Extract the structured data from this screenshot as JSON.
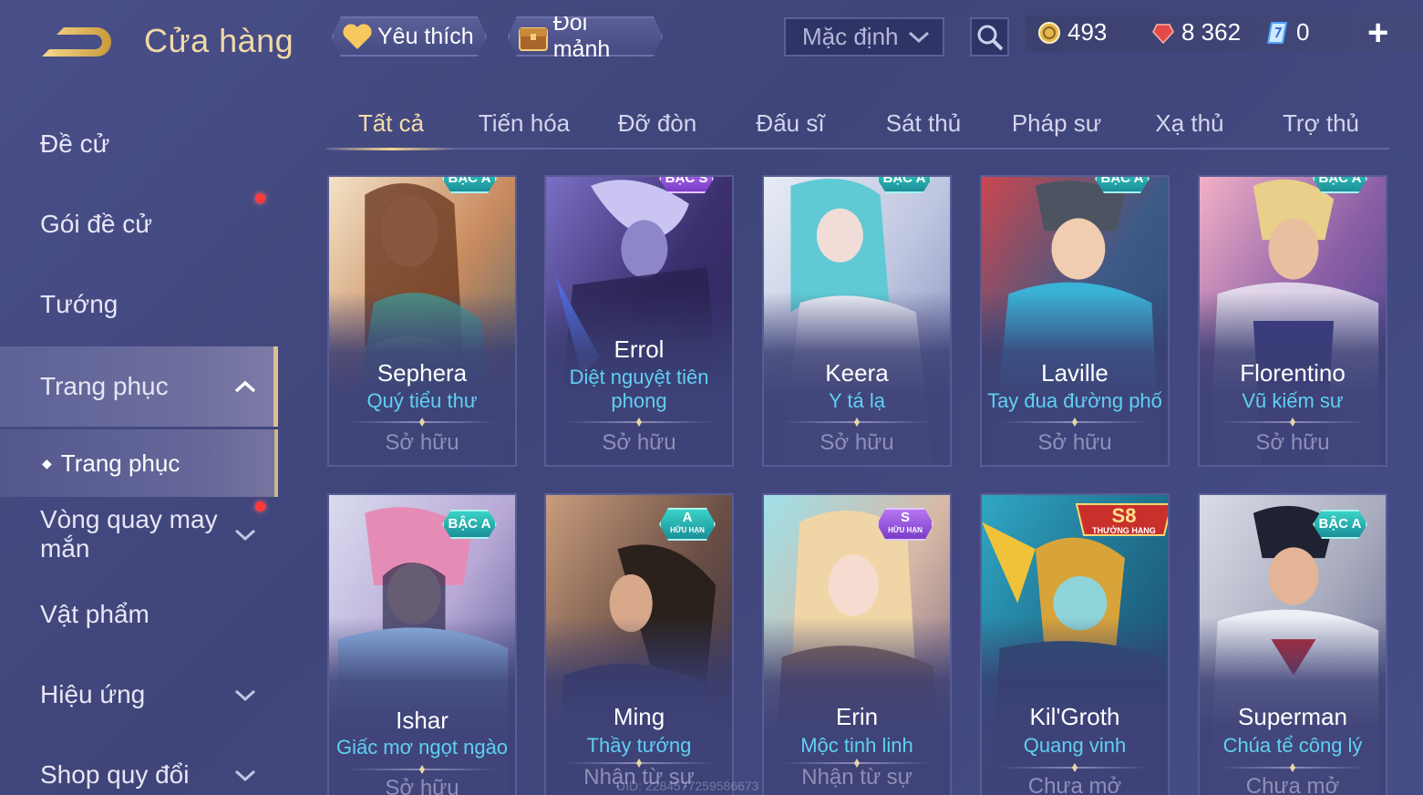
{
  "header": {
    "title": "Cửa hàng",
    "favorite_label": "Yêu thích",
    "exchange_label": "Đổi mảnh",
    "sort_value": "Mặc định",
    "currencies": [
      {
        "icon": "gold-coin-icon",
        "value": "493"
      },
      {
        "icon": "red-gem-icon",
        "value": "8 362"
      },
      {
        "icon": "voucher-icon",
        "value": "0"
      }
    ],
    "add_label": "+"
  },
  "sidebar": {
    "items": [
      {
        "label": "Đề cử"
      },
      {
        "label": "Gói đề cử"
      },
      {
        "label": "Tướng"
      },
      {
        "label": "Trang phục"
      },
      {
        "label": "Trang phục"
      },
      {
        "label": "Vòng quay may mắn"
      },
      {
        "label": "Vật phẩm"
      },
      {
        "label": "Hiệu ứng"
      },
      {
        "label": "Shop quy đổi"
      }
    ]
  },
  "tabs": [
    "Tất cả",
    "Tiến hóa",
    "Đỡ đòn",
    "Đấu sĩ",
    "Sát thủ",
    "Pháp sư",
    "Xạ thủ",
    "Trợ thủ"
  ],
  "cards": [
    {
      "hero": "Sephera",
      "skin": "Quý tiểu thư",
      "status": "Sở hữu",
      "badge": "BẬC A"
    },
    {
      "hero": "Errol",
      "skin": "Diệt nguyệt tiên phong",
      "status": "Sở hữu",
      "badge": "BẬC S"
    },
    {
      "hero": "Keera",
      "skin": "Y tá lạ",
      "status": "Sở hữu",
      "badge": "BẬC A"
    },
    {
      "hero": "Laville",
      "skin": "Tay đua đường phố",
      "status": "Sở hữu",
      "badge": "BẬC A"
    },
    {
      "hero": "Florentino",
      "skin": "Vũ kiếm sư",
      "status": "Sở hữu",
      "badge": "BẬC A"
    },
    {
      "hero": "Ishar",
      "skin": "Giấc mơ ngọt ngào",
      "status": "Sở hữu",
      "badge": "BẬC A"
    },
    {
      "hero": "Ming",
      "skin": "Thầy tướng",
      "status": "Nhận từ sự",
      "badge": "A",
      "badge_sub": "HỮU HẠN"
    },
    {
      "hero": "Erin",
      "skin": "Mộc tinh linh",
      "status": "Nhận từ sự",
      "badge": "S",
      "badge_sub": "HỮU HẠN"
    },
    {
      "hero": "Kil'Groth",
      "skin": "Quang vinh",
      "status": "Chưa mở",
      "badge": "S8",
      "badge_sub": "THƯỞNG HẠNG"
    },
    {
      "hero": "Superman",
      "skin": "Chúa tể công lý",
      "status": "Chưa mở",
      "badge": "BẬC A"
    }
  ],
  "uid_text": "UID: 2284577259586673",
  "colors": {
    "accent_gold": "#f1d9a6",
    "skin_name": "#5fd0f2",
    "red_dot": "#ff3a3a"
  }
}
